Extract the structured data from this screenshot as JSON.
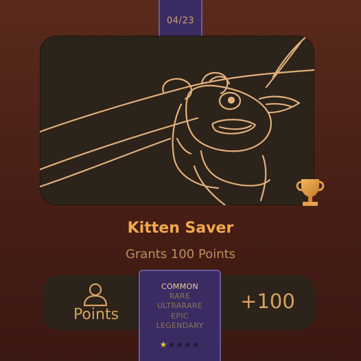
{
  "counter": "04/23",
  "achievement": {
    "title": "Kitten Saver",
    "subtitle": "Grants 100 Points",
    "points_label": "Points",
    "reward": "+100"
  },
  "rarity": {
    "levels": [
      "COMMON",
      "RARE",
      "ULTRARARE",
      "EPIC",
      "LEGENDARY"
    ],
    "selected": "COMMON",
    "stars_filled": 1,
    "stars_total": 5
  },
  "icons": {
    "trophy": "trophy-icon",
    "points": "person-icon",
    "star": "star-icon"
  },
  "colors": {
    "accent": "#f0a94e",
    "card_purple": "#3a2b63",
    "panel_dark": "#2c231a",
    "background": "#4a2017"
  }
}
